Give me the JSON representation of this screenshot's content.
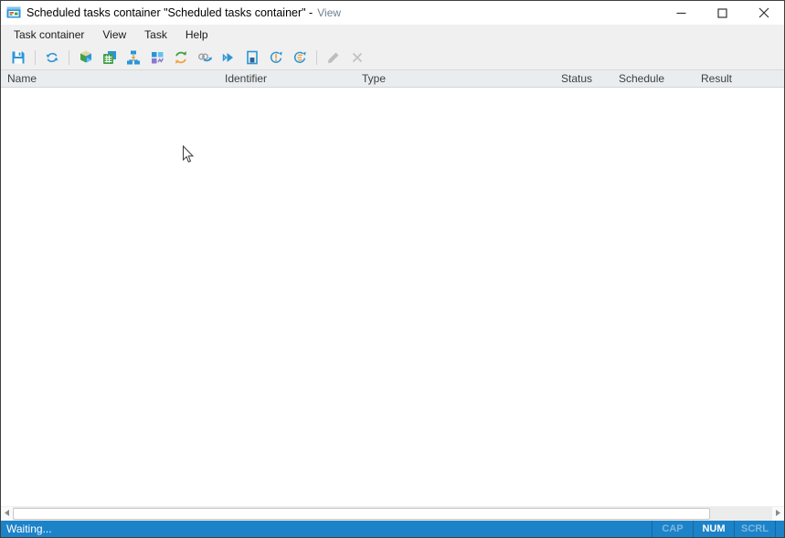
{
  "window": {
    "title": "Scheduled tasks container \"Scheduled tasks container\" -",
    "title_view": "View"
  },
  "menu": {
    "items": [
      "Task container",
      "View",
      "Task",
      "Help"
    ]
  },
  "toolbar": {
    "icons": [
      "save-icon",
      "refresh-icon",
      "data-cube-icon",
      "spreadsheet-icon",
      "structure-icon",
      "performance-blocks-icon",
      "recurring-task-icon",
      "links-icon",
      "run-icon",
      "container-icon",
      "refresh-status-icon",
      "refresh-schedule-icon",
      "edit-icon",
      "delete-icon"
    ]
  },
  "table": {
    "columns": [
      "Name",
      "Identifier",
      "Type",
      "Status",
      "Schedule",
      "Result"
    ],
    "rows": []
  },
  "statusbar": {
    "message": "Waiting...",
    "indicators": [
      {
        "label": "CAP",
        "active": false
      },
      {
        "label": "NUM",
        "active": true
      },
      {
        "label": "SCRL",
        "active": false
      }
    ]
  },
  "colors": {
    "accent_blue": "#2b95d6",
    "statusbar_blue": "#1d83c9",
    "icon_green": "#43a047",
    "icon_orange": "#f2a33c",
    "icon_purple": "#8878d0",
    "disabled_gray": "#bdbdbd"
  }
}
